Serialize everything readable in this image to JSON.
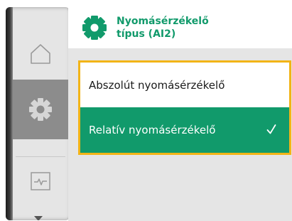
{
  "header": {
    "title_line1": "Nyomásérzékelő",
    "title_line2": "típus (AI2)",
    "icon": "gear-icon"
  },
  "nav": {
    "items": [
      {
        "icon": "home-icon",
        "active": false
      },
      {
        "icon": "settings-gear-icon",
        "active": true
      },
      {
        "icon": "diagnostics-icon",
        "active": false
      }
    ]
  },
  "options": [
    {
      "label": "Abszolút nyomásérzékelő",
      "selected": false
    },
    {
      "label": "Relatív nyomásérzékelő",
      "selected": true
    }
  ],
  "colors": {
    "accent_green": "#119a6b",
    "focus_yellow": "#f2b417",
    "nav_active": "#8c8c8c",
    "background": "#e5e5e5"
  }
}
